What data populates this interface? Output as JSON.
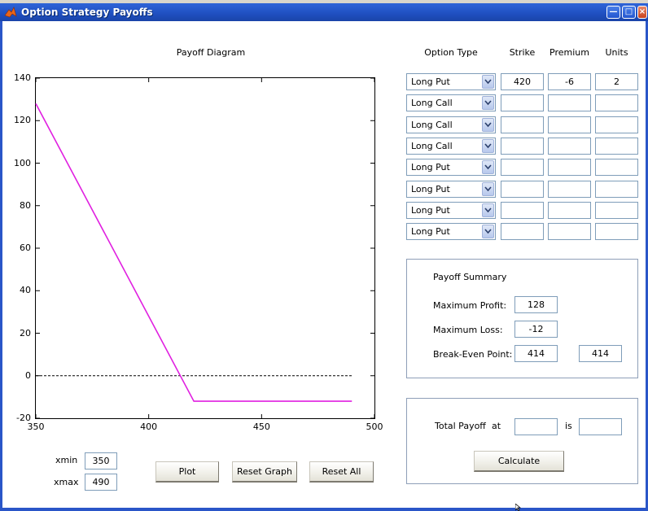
{
  "window": {
    "title": "Option Strategy Payoffs"
  },
  "plot": {
    "title": "Payoff Diagram",
    "zero_line": "dashed black",
    "line_color": "#e020e0"
  },
  "chart_data": {
    "type": "line",
    "title": "Payoff Diagram",
    "xlabel": "",
    "ylabel": "",
    "xlim": [
      350,
      500
    ],
    "ylim": [
      -20,
      140
    ],
    "xticks": [
      "350",
      "400",
      "450",
      "500"
    ],
    "yticks": [
      "-20",
      "0",
      "20",
      "40",
      "60",
      "80",
      "100",
      "120",
      "140"
    ],
    "series": [
      {
        "color": "#e020e0",
        "x": [
          350,
          420,
          490
        ],
        "y": [
          128,
          -12,
          -12
        ]
      }
    ],
    "reference_line": {
      "y": 0,
      "x": [
        350,
        490
      ],
      "style": "dashed"
    },
    "grid": false
  },
  "table": {
    "headers": {
      "type": "Option Type",
      "strike": "Strike",
      "premium": "Premium",
      "units": "Units"
    },
    "rows": [
      {
        "type": "Long Put",
        "strike": "420",
        "premium": "-6",
        "units": "2"
      },
      {
        "type": "Long Call",
        "strike": "",
        "premium": "",
        "units": ""
      },
      {
        "type": "Long Call",
        "strike": "",
        "premium": "",
        "units": ""
      },
      {
        "type": "Long Call",
        "strike": "",
        "premium": "",
        "units": ""
      },
      {
        "type": "Long Put",
        "strike": "",
        "premium": "",
        "units": ""
      },
      {
        "type": "Long Put",
        "strike": "",
        "premium": "",
        "units": ""
      },
      {
        "type": "Long Put",
        "strike": "",
        "premium": "",
        "units": ""
      },
      {
        "type": "Long Put",
        "strike": "",
        "premium": "",
        "units": ""
      }
    ]
  },
  "summary": {
    "title": "Payoff Summary",
    "max_profit_label": "Maximum Profit:",
    "max_profit": "128",
    "max_loss_label": "Maximum Loss:",
    "max_loss": "-12",
    "breakeven_label": "Break-Even Point:",
    "breakeven_1": "414",
    "breakeven_2": "414"
  },
  "total": {
    "label": "Total Payoff",
    "at_label": "at",
    "is_label": "is",
    "at_value": "",
    "is_value": "",
    "calculate_label": "Calculate"
  },
  "range": {
    "xmin_label": "xmin",
    "xmin": "350",
    "xmax_label": "xmax",
    "xmax": "490"
  },
  "buttons": {
    "plot": "Plot",
    "reset_graph": "Reset Graph",
    "reset_all": "Reset All"
  }
}
